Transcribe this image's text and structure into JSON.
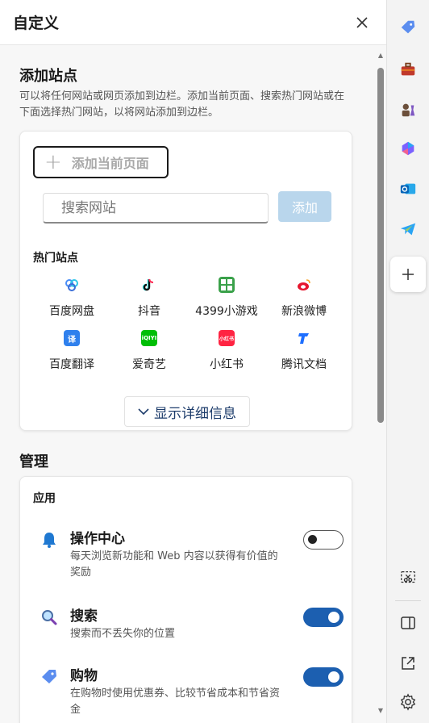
{
  "header": {
    "title": "自定义"
  },
  "add_site": {
    "title": "添加站点",
    "description": "可以将任何网站或网页添加到边栏。添加当前页面、搜索热门网站或在下面选择热门网站，以将网站添加到边栏。",
    "add_current_label": "添加当前页面",
    "search_placeholder": "搜索网站",
    "add_button_label": "添加",
    "popular_title": "热门站点",
    "sites": [
      {
        "label": "百度网盘",
        "icon": "baidu-netdisk-icon",
        "color": "#4a8ef7"
      },
      {
        "label": "抖音",
        "icon": "douyin-icon",
        "color": "#111111"
      },
      {
        "label": "4399小游戏",
        "icon": "4399-icon",
        "color": "#3aa14a"
      },
      {
        "label": "新浪微博",
        "icon": "weibo-icon",
        "color": "#e6162d"
      },
      {
        "label": "百度翻译",
        "icon": "baidu-translate-icon",
        "color": "#2f80ed"
      },
      {
        "label": "爱奇艺",
        "icon": "iqiyi-icon",
        "color": "#00be06"
      },
      {
        "label": "小红书",
        "icon": "xiaohongshu-icon",
        "color": "#ff2442"
      },
      {
        "label": "腾讯文档",
        "icon": "tencent-docs-icon",
        "color": "#1e6fff"
      }
    ],
    "details_button_label": "显示详细信息"
  },
  "manage": {
    "title": "管理",
    "apps_title": "应用",
    "apps": [
      {
        "name": "操作中心",
        "desc": "每天浏览新功能和 Web 内容以获得有价值的奖励",
        "enabled": false,
        "icon": "bell-icon"
      },
      {
        "name": "搜索",
        "desc": "搜索而不丢失你的位置",
        "enabled": true,
        "icon": "search-icon"
      },
      {
        "name": "购物",
        "desc": "在购物时使用优惠券、比较节省成本和节省资金",
        "enabled": true,
        "icon": "shopping-tag-icon"
      }
    ]
  },
  "sidebar": {
    "items": [
      "shopping-tag-icon",
      "toolbox-icon",
      "games-icon",
      "copilot-icon",
      "outlook-icon",
      "telegram-icon",
      "add-icon",
      "screenshot-icon",
      "split-panel-icon",
      "open-external-icon",
      "settings-icon"
    ]
  }
}
